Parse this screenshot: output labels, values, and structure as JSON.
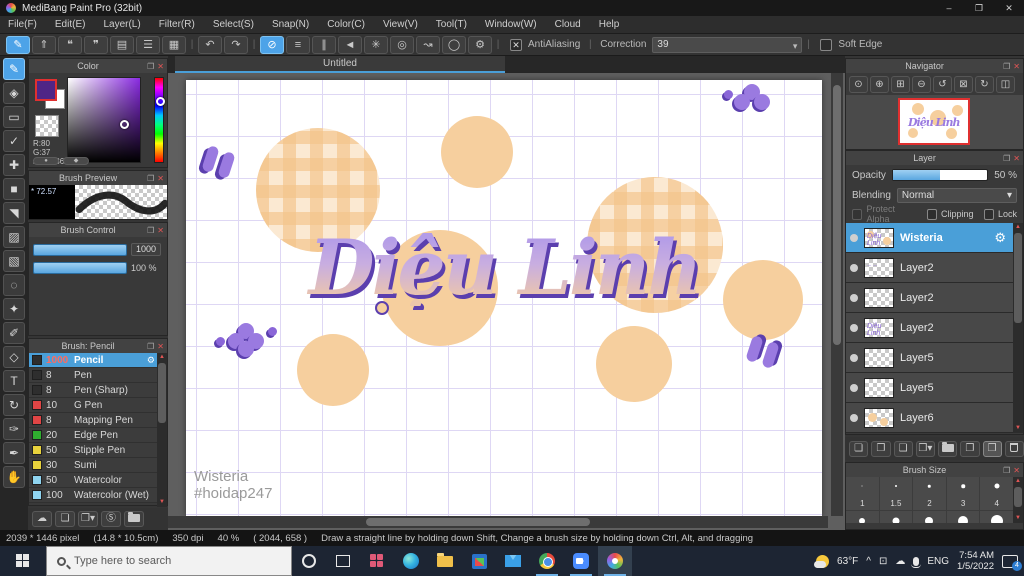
{
  "window": {
    "title": "MediBang Paint Pro (32bit)"
  },
  "icons": {
    "minimize": "–",
    "maximize": "❐",
    "close": "✕",
    "brush": "✎",
    "publish": "⇑",
    "comment": "❝",
    "comment_lines": "❞",
    "document": "▤",
    "list_panel": "☰",
    "cells": "▦",
    "undo": "↶",
    "redo": "↷",
    "snap_off": "⊘",
    "snap_parallel": "≡",
    "snap_grid": "∥",
    "snap_vanish": "◄",
    "snap_radial": "✳",
    "snap_circle": "◎",
    "snap_curve": "↝",
    "snap_ellipse": "◯",
    "snap_settings": "⚙",
    "check_x": "✕",
    "caret": "▾",
    "eraser": "◈",
    "shape_brush": "▭",
    "dot_pen": "✓",
    "move": "✚",
    "fill_rect": "■",
    "bucket": "◥",
    "gradient": "▨",
    "select": "▧",
    "lasso": "◌",
    "magic_wand": "✦",
    "select_pen": "✐",
    "select_eraser": "◇",
    "text_tool": "T",
    "rotate_view": "↻",
    "divide": "✑",
    "eyedropper": "✒",
    "hand": "✋",
    "popout": "❐",
    "panel_close": "✕",
    "gear": "⚙",
    "zoom_actual": "⊙",
    "zoom_in": "⊕",
    "fit_screen": "⊞",
    "zoom_out": "⊖",
    "rotate_ccw": "↺",
    "reset_view": "⊠",
    "rotate_cw": "↻",
    "flip": "◫",
    "scroll_up": "▲",
    "scroll_down": "▼",
    "cloud_upload": "☁",
    "page_new": "❏",
    "page_copy": "❐",
    "page_s": "Ⓢ",
    "layer_new": "❏",
    "layer_copy": "❐",
    "layer_up": "❑",
    "layer_add": "❒",
    "layer_combine": "❐",
    "layer_merge": "❒",
    "tray_chevron": "^",
    "tray_window": "⊡",
    "tray_cloud": "☁"
  },
  "menu": {
    "items": [
      "File(F)",
      "Edit(E)",
      "Layer(L)",
      "Filter(R)",
      "Select(S)",
      "Snap(N)",
      "Color(C)",
      "View(V)",
      "Tool(T)",
      "Window(W)",
      "Cloud",
      "Help"
    ]
  },
  "toolbar": {
    "antialiasing_label": "AntiAliasing",
    "correction_label": "Correction",
    "correction_value": "39",
    "soft_edge_label": "Soft Edge"
  },
  "color_panel": {
    "title": "Color",
    "r": "R:80",
    "g": "G:37",
    "hex": "#502586",
    "fg_color": "#502586"
  },
  "brush_preview": {
    "title": "Brush Preview",
    "zoom": "* 72.57"
  },
  "brush_control": {
    "title": "Brush Control",
    "size_value": "1000",
    "opacity_value": "100 %"
  },
  "brush_panel": {
    "title": "Brush: Pencil",
    "brushes": [
      {
        "size": "1000",
        "name": "Pencil",
        "color": "#2e2e2e"
      },
      {
        "size": "8",
        "name": "Pen",
        "color": "#2e2e2e"
      },
      {
        "size": "8",
        "name": "Pen (Sharp)",
        "color": "#2e2e2e"
      },
      {
        "size": "10",
        "name": "G Pen",
        "color": "#e04545"
      },
      {
        "size": "8",
        "name": "Mapping Pen",
        "color": "#e04545"
      },
      {
        "size": "20",
        "name": "Edge Pen",
        "color": "#2fae2f"
      },
      {
        "size": "50",
        "name": "Stipple Pen",
        "color": "#e8d23c"
      },
      {
        "size": "30",
        "name": "Sumi",
        "color": "#e8d23c"
      },
      {
        "size": "50",
        "name": "Watercolor",
        "color": "#8fd4f0"
      },
      {
        "size": "100",
        "name": "Watercolor (Wet)",
        "color": "#8fd4f0"
      }
    ]
  },
  "canvas": {
    "tab": "Untitled",
    "art_text": "Diệu Linh",
    "watermark_line1": "Wisteria",
    "watermark_line2": "#hoidap247"
  },
  "navigator": {
    "title": "Navigator"
  },
  "layer_panel": {
    "title": "Layer",
    "opacity_label": "Opacity",
    "opacity_value": "50 %",
    "blending_label": "Blending",
    "blending_value": "Normal",
    "protect_alpha_label": "Protect Alpha",
    "clipping_label": "Clipping",
    "lock_label": "Lock",
    "layers": [
      {
        "name": "Wisteria"
      },
      {
        "name": "Layer2"
      },
      {
        "name": "Layer2"
      },
      {
        "name": "Layer2"
      },
      {
        "name": "Layer5"
      },
      {
        "name": "Layer5"
      },
      {
        "name": "Layer6"
      }
    ]
  },
  "brush_size_panel": {
    "title": "Brush Size",
    "sizes": [
      "1",
      "1.5",
      "2",
      "3",
      "4"
    ]
  },
  "status_bar": {
    "segments": [
      "2039 * 1446 pixel",
      "(14.8 * 10.5cm)",
      "350 dpi",
      "40 %",
      "( 2044, 658 )",
      "Draw a straight line by holding down Shift, Change a brush size by holding down Ctrl, Alt, and dragging"
    ]
  },
  "taskbar": {
    "search_placeholder": "Type here to search",
    "temperature": "63°F",
    "language": "ENG",
    "time": "7:54 AM",
    "date": "1/5/2022",
    "notification_count": "4"
  }
}
